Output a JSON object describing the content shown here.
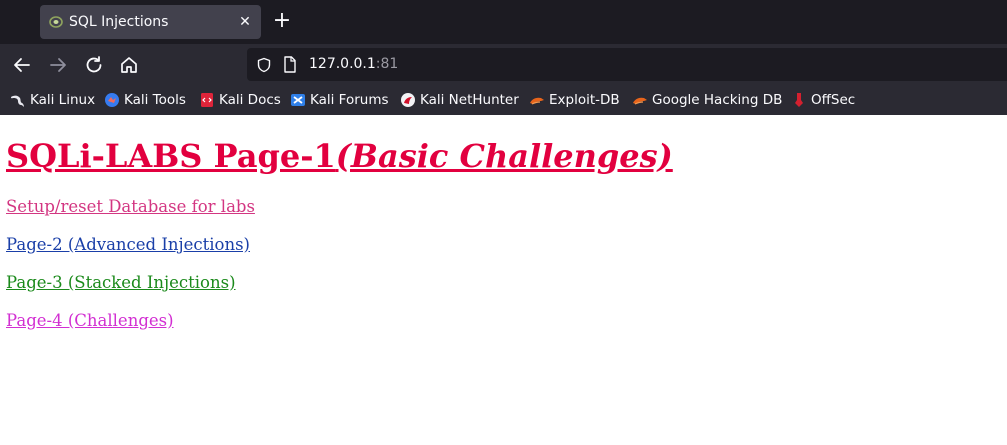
{
  "browser": {
    "tab": {
      "title": "SQL Injections",
      "close_glyph": "✕"
    },
    "new_tab_glyph": "+",
    "url": {
      "host": "127.0.0.1",
      "port": ":81"
    },
    "bookmarks": [
      {
        "label": "Kali Linux",
        "icon": "kali-dragon-icon"
      },
      {
        "label": "Kali Tools",
        "icon": "kali-tools-icon"
      },
      {
        "label": "Kali Docs",
        "icon": "kali-docs-icon"
      },
      {
        "label": "Kali Forums",
        "icon": "kali-forums-icon"
      },
      {
        "label": "Kali NetHunter",
        "icon": "nethunter-icon"
      },
      {
        "label": "Exploit-DB",
        "icon": "exploit-db-icon"
      },
      {
        "label": "Google Hacking DB",
        "icon": "ghdb-icon"
      },
      {
        "label": "OffSec",
        "icon": "offsec-icon"
      }
    ]
  },
  "page": {
    "heading_main": "SQLi-LABS Page-1",
    "heading_italic": "(Basic Challenges)",
    "heading_color": "#e2003f",
    "links": [
      {
        "label": "Setup/reset Database for labs",
        "color": "#d33682"
      },
      {
        "label": "Page-2 (Advanced Injections)",
        "color": "#1a3fa8"
      },
      {
        "label": "Page-3 (Stacked Injections)",
        "color": "#1b8a1b"
      },
      {
        "label": "Page-4 (Challenges)",
        "color": "#d22fd2"
      }
    ]
  }
}
